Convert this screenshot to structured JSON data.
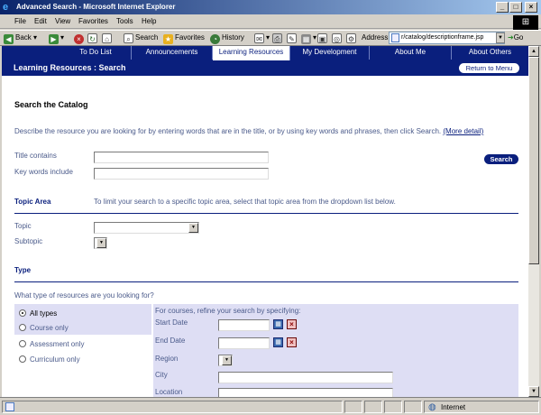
{
  "window": {
    "title": "Advanced Search - Microsoft Internet Explorer"
  },
  "menu": {
    "items": [
      "File",
      "Edit",
      "View",
      "Favorites",
      "Tools",
      "Help"
    ]
  },
  "toolbar": {
    "back": "Back",
    "search": "Search",
    "favorites": "Favorites",
    "history": "History",
    "address_label": "Address",
    "address_value": "r/catalog/descriptionframe.jsp",
    "go": "Go"
  },
  "nav": {
    "tabs": [
      "To Do List",
      "Announcements",
      "Learning Resources",
      "My Development",
      "About Me",
      "About Others"
    ],
    "active": "Learning Resources",
    "breadcrumb": "Learning Resources  :  Search",
    "return_label": "Return to Menu"
  },
  "catalog": {
    "heading": "Search the Catalog",
    "description": "Describe the resource you are looking for by entering words that are in the title, or by using key words and phrases, then click Search.",
    "more_detail": "(More detail)",
    "title_label": "Title contains",
    "keywords_label": "Key words include",
    "search_button": "Search"
  },
  "topic": {
    "heading": "Topic Area",
    "hint": "To limit your search to a specific topic area, select that topic area from the dropdown list below.",
    "topic_label": "Topic",
    "subtopic_label": "Subtopic"
  },
  "type": {
    "heading": "Type",
    "question": "What type of resources are you looking for?",
    "options": [
      "All types",
      "Course only",
      "Assessment only",
      "Curriculum only"
    ],
    "selected": "All types",
    "refine_text": "For courses, refine your search by specifying:",
    "fields": [
      "Start Date",
      "End Date",
      "Region",
      "City",
      "Location"
    ]
  },
  "status": {
    "zone": "Internet"
  },
  "colors": {
    "navy": "#0a1f7d",
    "panel": "#dedef4",
    "label": "#4a5a8a"
  }
}
